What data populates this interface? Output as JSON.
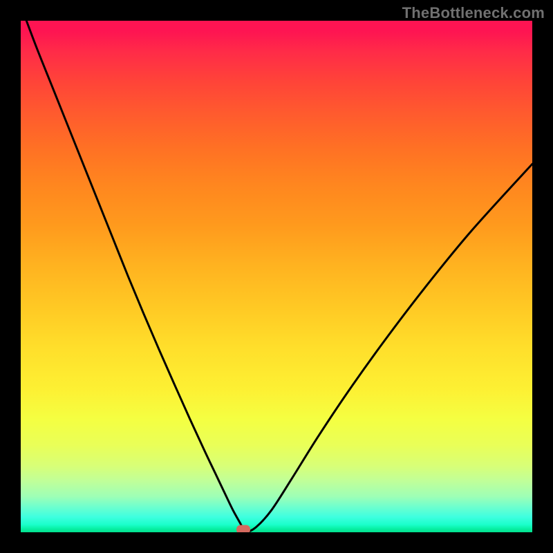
{
  "watermark": "TheBottleneck.com",
  "colors": {
    "frame_bg": "#000000",
    "curve_stroke": "#000000",
    "marker_fill": "#d46a5f",
    "gradient_top": "#fe1452",
    "gradient_bottom": "#02e08e"
  },
  "chart_data": {
    "type": "line",
    "title": "",
    "xlabel": "",
    "ylabel": "",
    "xlim": [
      0,
      100
    ],
    "ylim": [
      0,
      100
    ],
    "grid": false,
    "series": [
      {
        "name": "bottleneck-curve",
        "x": [
          0,
          3,
          6,
          9,
          12,
          15,
          18,
          21,
          24,
          27,
          30,
          33,
          36,
          38,
          40,
          41.5,
          43,
          43.5,
          44,
          46,
          49,
          53,
          58,
          64,
          71,
          79,
          88,
          100
        ],
        "y": [
          103,
          95,
          87.5,
          80,
          72.5,
          65,
          57.5,
          50,
          42.8,
          35.8,
          29,
          22.3,
          15.8,
          11.6,
          7.4,
          4.3,
          1.6,
          0.6,
          0,
          1,
          4.3,
          10.5,
          18.5,
          27.5,
          37.3,
          47.8,
          58.8,
          72
        ]
      }
    ],
    "marker": {
      "x": 43.5,
      "y": 0.6
    },
    "legend": null
  }
}
